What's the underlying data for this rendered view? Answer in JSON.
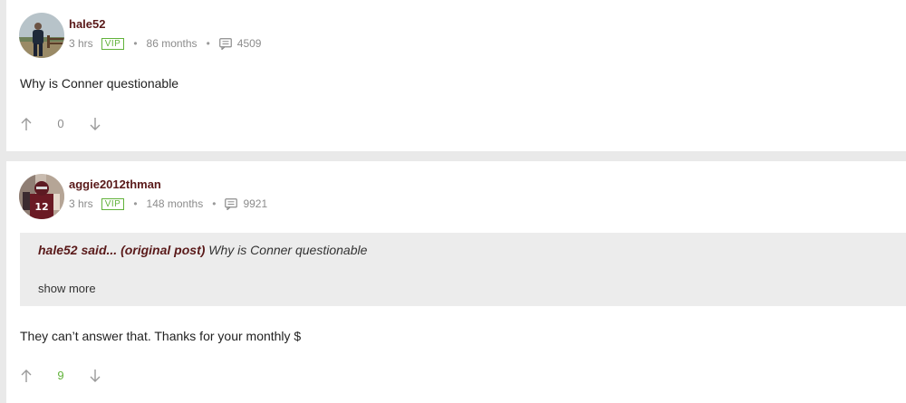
{
  "posts": [
    {
      "username": "hale52",
      "time": "3 hrs",
      "badge": "VIP",
      "tenure": "86 months",
      "post_count": "4509",
      "body": "Why is Conner questionable",
      "score": "0",
      "score_color": "#8c8c8c",
      "avatar_icon": "user-photo-avatar"
    },
    {
      "username": "aggie2012thman",
      "time": "3 hrs",
      "badge": "VIP",
      "tenure": "148 months",
      "post_count": "9921",
      "quote": {
        "author": "hale52",
        "said": "said...",
        "label": "(original post)",
        "text": "Why is Conner questionable",
        "show_more": "show more"
      },
      "body": "They can’t answer that. Thanks for your monthly $",
      "score": "9",
      "score_color": "#61b23a",
      "avatar_icon": "football-player-avatar"
    }
  ],
  "colors": {
    "username": "#5a1a1a",
    "vip": "#61b23a",
    "meta": "#8c8c8c",
    "quote_bg": "#ececec",
    "page_bg": "#e9e9e9"
  }
}
